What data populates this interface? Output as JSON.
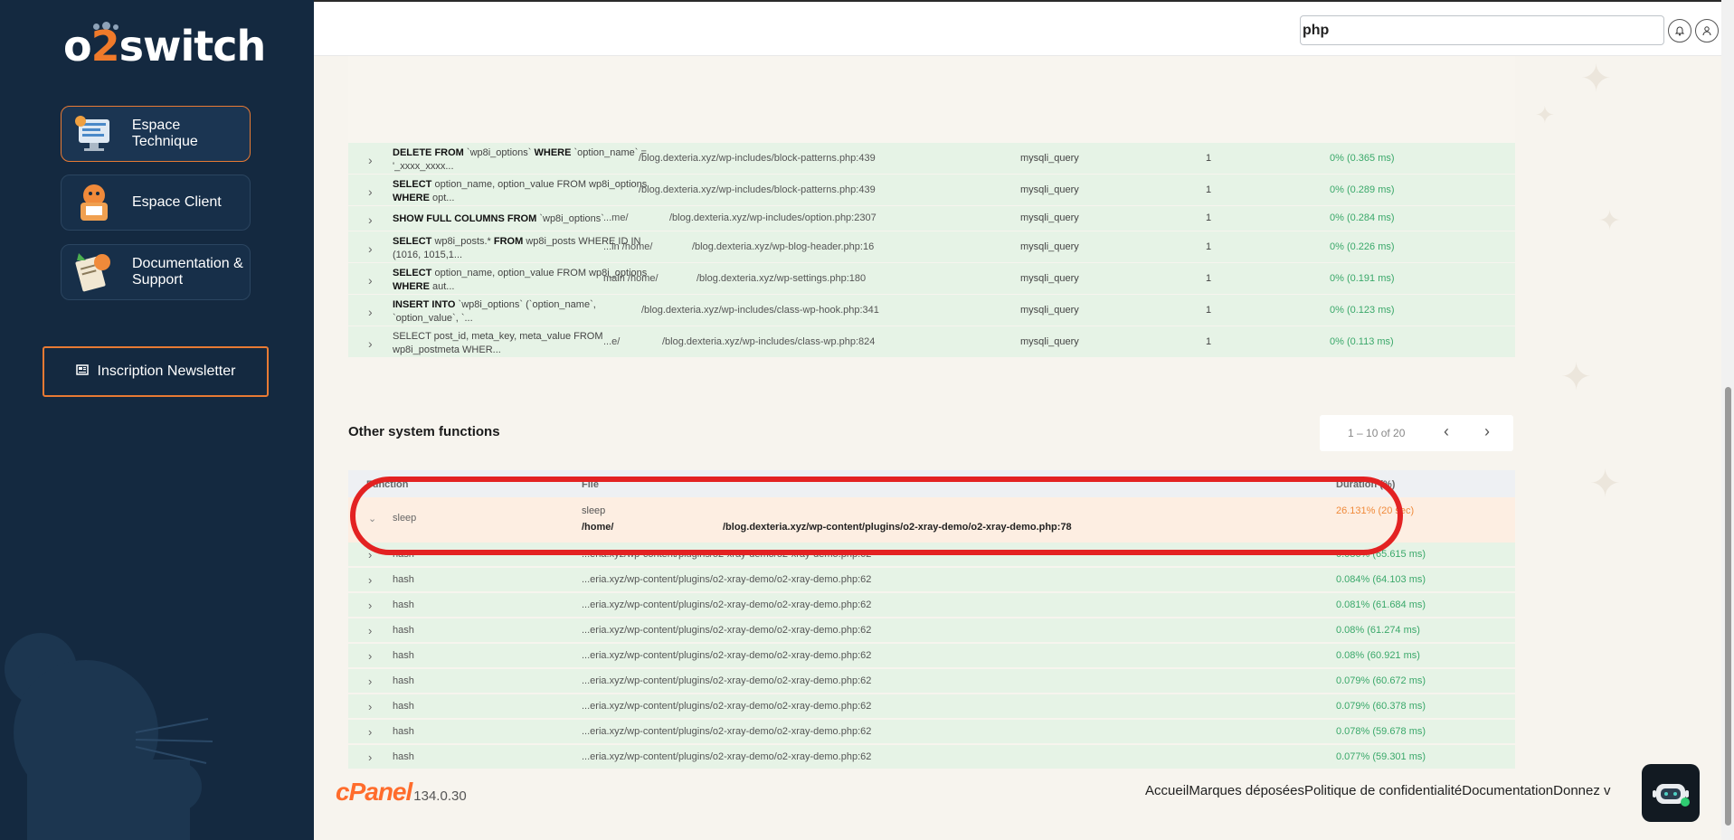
{
  "sidebar": {
    "logo": {
      "pre": "o",
      "accent": "2",
      "post": "switch"
    },
    "nav": [
      {
        "label": "Espace Technique",
        "icon": "tech-space-icon",
        "active": true
      },
      {
        "label": "Espace Client",
        "icon": "client-space-icon",
        "active": false
      },
      {
        "label": "Documentation & Support",
        "icon": "documentation-icon",
        "active": false
      }
    ],
    "newsletter_label": "Inscription Newsletter"
  },
  "topbar": {
    "search_value": "php",
    "bell_icon": "bell-icon",
    "user_icon": "user-icon"
  },
  "queries": [
    {
      "q_parts": [
        "DELETE FROM",
        " `wp8i_options` ",
        "WHERE",
        " `option_name` = '_xxxx_xxxx..."
      ],
      "file_a": "",
      "file_b": "/blog.dexteria.xyz/wp-includes/block-patterns.php:439",
      "caller": "mysqli_query",
      "count": "1",
      "duration": "0% (0.365 ms)"
    },
    {
      "q_parts": [
        "SELECT",
        " option_name, option_value FROM wp8i_options ",
        "WHERE",
        " opt..."
      ],
      "file_a": "",
      "file_b": "/blog.dexteria.xyz/wp-includes/block-patterns.php:439",
      "caller": "mysqli_query",
      "count": "1",
      "duration": "0% (0.289 ms)"
    },
    {
      "q_parts": [
        "SHOW FULL COLUMNS FROM",
        " `wp8i_options`",
        "",
        ""
      ],
      "file_a": "...me/",
      "file_b": "/blog.dexteria.xyz/wp-includes/option.php:2307",
      "caller": "mysqli_query",
      "count": "1",
      "duration": "0% (0.284 ms)"
    },
    {
      "q_parts": [
        "SELECT",
        " wp8i_posts.* ",
        "FROM",
        " wp8i_posts WHERE ID IN (1016, 1015,1..."
      ],
      "file_a": "...in /home/",
      "file_b": "/blog.dexteria.xyz/wp-blog-header.php:16",
      "caller": "mysqli_query",
      "count": "1",
      "duration": "0% (0.226 ms)"
    },
    {
      "q_parts": [
        "SELECT",
        " option_name, option_value FROM wp8i_options ",
        "WHERE",
        " aut..."
      ],
      "file_a": "main /home/",
      "file_b": "/blog.dexteria.xyz/wp-settings.php:180",
      "caller": "mysqli_query",
      "count": "1",
      "duration": "0% (0.191 ms)"
    },
    {
      "q_parts": [
        "INSERT INTO",
        " `wp8i_options` (`option_name`, `option_value`, `...",
        "",
        ""
      ],
      "file_a": "",
      "file_b": "/blog.dexteria.xyz/wp-includes/class-wp-hook.php:341",
      "caller": "mysqli_query",
      "count": "1",
      "duration": "0% (0.123 ms)"
    },
    {
      "q_parts": [
        "",
        "SELECT post_id, meta_key, meta_value FROM wp8i_postmeta WHER...",
        "",
        ""
      ],
      "file_a": "...e/",
      "file_b": "/blog.dexteria.xyz/wp-includes/class-wp.php:824",
      "caller": "mysqli_query",
      "count": "1",
      "duration": "0% (0.113 ms)"
    }
  ],
  "other": {
    "title": "Other system functions",
    "pager_range": "1 – 10 of 20",
    "headers": {
      "function": "Function",
      "file": "File",
      "duration": "Duration (%)"
    },
    "sleep": {
      "fn": "sleep",
      "file_line1": "sleep",
      "file_home": "/home/",
      "file_path": "/blog.dexteria.xyz/wp-content/plugins/o2-xray-demo/o2-xray-demo.php:78",
      "duration": "26.131% (20 sec)"
    },
    "rows": [
      {
        "fn": "hash",
        "file": "...eria.xyz/wp-content/plugins/o2-xray-demo/o2-xray-demo.php:62",
        "duration": "0.086% (65.615 ms)"
      },
      {
        "fn": "hash",
        "file": "...eria.xyz/wp-content/plugins/o2-xray-demo/o2-xray-demo.php:62",
        "duration": "0.084% (64.103 ms)"
      },
      {
        "fn": "hash",
        "file": "...eria.xyz/wp-content/plugins/o2-xray-demo/o2-xray-demo.php:62",
        "duration": "0.081% (61.684 ms)"
      },
      {
        "fn": "hash",
        "file": "...eria.xyz/wp-content/plugins/o2-xray-demo/o2-xray-demo.php:62",
        "duration": "0.08% (61.274 ms)"
      },
      {
        "fn": "hash",
        "file": "...eria.xyz/wp-content/plugins/o2-xray-demo/o2-xray-demo.php:62",
        "duration": "0.08% (60.921 ms)"
      },
      {
        "fn": "hash",
        "file": "...eria.xyz/wp-content/plugins/o2-xray-demo/o2-xray-demo.php:62",
        "duration": "0.079% (60.672 ms)"
      },
      {
        "fn": "hash",
        "file": "...eria.xyz/wp-content/plugins/o2-xray-demo/o2-xray-demo.php:62",
        "duration": "0.079% (60.378 ms)"
      },
      {
        "fn": "hash",
        "file": "...eria.xyz/wp-content/plugins/o2-xray-demo/o2-xray-demo.php:62",
        "duration": "0.078% (59.678 ms)"
      },
      {
        "fn": "hash",
        "file": "...eria.xyz/wp-content/plugins/o2-xray-demo/o2-xray-demo.php:62",
        "duration": "0.077% (59.301 ms)"
      }
    ]
  },
  "footer": {
    "brand": "cPanel",
    "version": "134.0.30",
    "links": [
      "Accueil",
      "Marques déposées",
      "Politique de confidentialité",
      "Documentation",
      "Donnez v"
    ]
  },
  "colors": {
    "accent": "#e87a34",
    "sidebar_bg": "#142940",
    "row_green": "#e6f3e6",
    "row_orange": "#fdeee2",
    "highlight": "#e32222"
  }
}
